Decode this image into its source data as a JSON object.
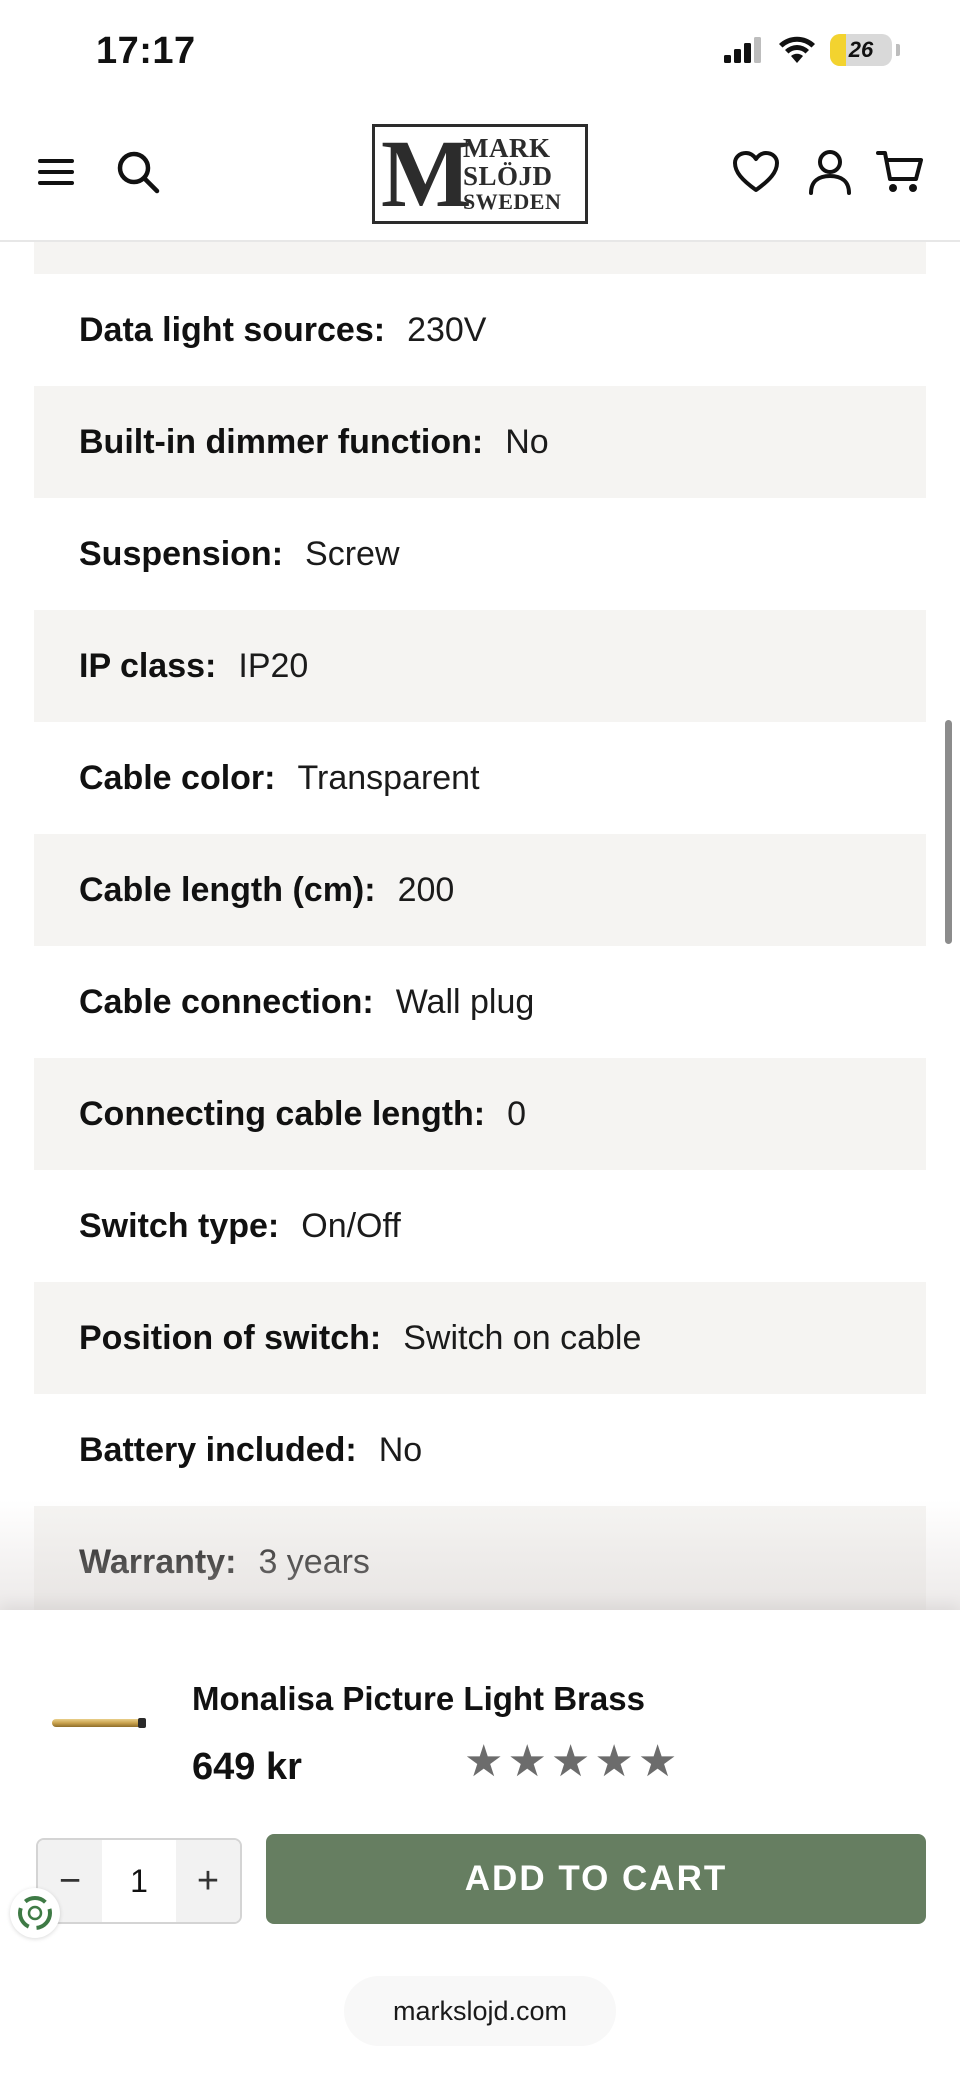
{
  "status_bar": {
    "time": "17:17",
    "battery_level": "26",
    "battery_fraction": 0.26,
    "battery_color": "#f3d32f"
  },
  "header": {
    "icons": [
      "menu-icon",
      "search-icon",
      "heart-icon",
      "account-icon",
      "cart-icon"
    ],
    "logo": {
      "letter": "M",
      "line1": "MARK",
      "line2": "SLÖJD",
      "line3": "SWEDEN"
    }
  },
  "specs": [
    {
      "label": "Data light sources:",
      "value": "230V"
    },
    {
      "label": "Built-in dimmer function:",
      "value": "No"
    },
    {
      "label": "Suspension:",
      "value": "Screw"
    },
    {
      "label": "IP class:",
      "value": "IP20"
    },
    {
      "label": "Cable color:",
      "value": "Transparent"
    },
    {
      "label": "Cable length (cm):",
      "value": "200"
    },
    {
      "label": "Cable connection:",
      "value": "Wall plug"
    },
    {
      "label": "Connecting cable length:",
      "value": "0"
    },
    {
      "label": "Switch type:",
      "value": "On/Off"
    },
    {
      "label": "Position of switch:",
      "value": "Switch on cable"
    },
    {
      "label": "Battery included:",
      "value": "No"
    },
    {
      "label": "Warranty:",
      "value": "3 years"
    }
  ],
  "product": {
    "name": "Monalisa Picture Light Brass",
    "price": "649 kr",
    "rating": 5,
    "star_glyph": "★",
    "quantity": "1",
    "decrement_symbol": "−",
    "increment_symbol": "+",
    "add_to_cart_label": "ADD TO CART"
  },
  "browser": {
    "url": "markslojd.com"
  },
  "colors": {
    "accent_green": "#667e61",
    "row_shade": "#f5f4f2",
    "star_gray": "#6c6c6c"
  }
}
